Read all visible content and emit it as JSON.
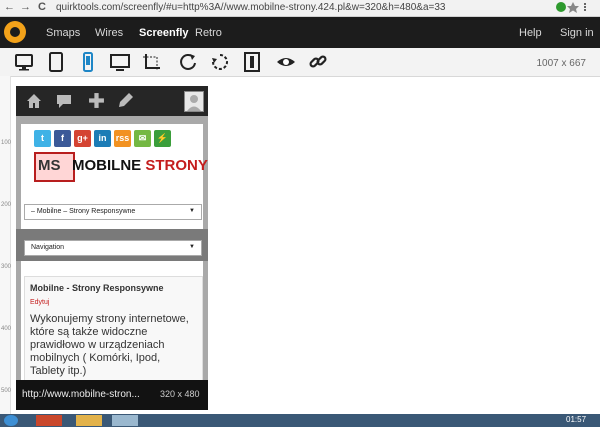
{
  "browser": {
    "url": "quirktools.com/screenfly/#u=http%3A//www.mobilne-strony.424.pl&w=320&h=480&a=33",
    "back_glyph": "←",
    "forward_glyph": "→",
    "reload_glyph": "C"
  },
  "menu": {
    "items": [
      "Smaps",
      "Wires",
      "Screenfly",
      "Retro"
    ],
    "right_items": [
      "Help",
      "Sign in"
    ]
  },
  "toolbar": {
    "icons": [
      "desktop-icon",
      "tablet-icon",
      "phone-icon",
      "tv-icon",
      "custom-size-icon",
      "rotate-icon",
      "refresh-icon",
      "scroll-icon",
      "preview-icon",
      "link-icon"
    ],
    "dimensions": "1007 x 667"
  },
  "ruler": {
    "ticks": [
      "100",
      "200",
      "300",
      "400",
      "500"
    ]
  },
  "site": {
    "top_icons": [
      "home-icon",
      "comment-icon",
      "plus-icon",
      "pencil-icon",
      "avatar"
    ],
    "social": [
      "t",
      "f",
      "g+",
      "in",
      "rss",
      "✉",
      "⚡"
    ],
    "logo_badge": "MS",
    "logo_text_a": "MOBILNE",
    "logo_text_b": "STRONY",
    "select1": "– Mobilne – Strony Responsywne",
    "nav_select": "Navigation",
    "card": {
      "title": "Mobilne - Strony Responsywne",
      "edit": "Edytuj",
      "body": "Wykonujemy strony internetowe, które są także widoczne prawidłowo w urządzeniach mobilnych ( Komórki, Ipod, Tablety itp.)"
    }
  },
  "status": {
    "url": "http://www.mobilne-stron...",
    "size": "320 x 480"
  },
  "taskbar": {
    "clock": "01:57"
  },
  "colors": {
    "accent": "#f3a21a",
    "brand_red": "#c41d1d"
  }
}
